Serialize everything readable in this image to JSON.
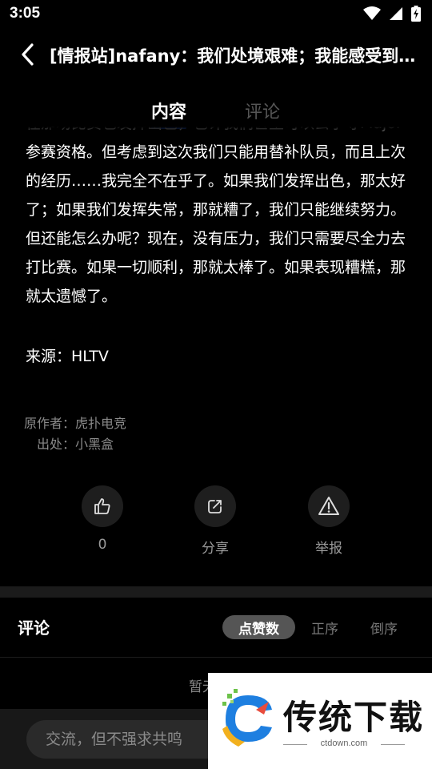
{
  "status_bar": {
    "time": "3:05"
  },
  "header": {
    "title": "[情报站]nafany：我们处境艰难；我能感受到…"
  },
  "tabs": [
    {
      "label": "内容",
      "active": true
    },
    {
      "label": "评论",
      "active": false
    }
  ],
  "article": {
    "paragraphs": [
      "在那场比赛也发挥出色，也许我们甚至可以去争夺Major参赛资格。但考虑到这次我们只能用替补队员，而且上次的经历……我完全不在乎了。如果我们发挥出色，那太好了；如果我们发挥失常，那就糟了，我们只能继续努力。但还能怎么办呢？现在，没有压力，我们只需要尽全力去打比赛。如果一切顺利，那就太棒了。如果表现糟糕，那就太遗憾了。"
    ],
    "source": "来源：HLTV"
  },
  "meta": {
    "author_label": "原作者：",
    "author": "虎扑电竞",
    "origin_label": "出处：",
    "origin": "小黑盒"
  },
  "actions": {
    "like_count": "0",
    "share_label": "分享",
    "report_label": "举报"
  },
  "comments": {
    "title": "评论",
    "sort_likes": "点赞数",
    "sort_asc": "正序",
    "sort_desc": "倒序",
    "empty_text": "暂无",
    "input_placeholder": "交流，但不强求共鸣"
  },
  "watermark": {
    "name": "传统下载",
    "url": "ctdown.com"
  },
  "colors": {
    "background": "#000000",
    "accent_blue": "#2f6fff",
    "muted_text": "#8a8a8a",
    "sort_active_bg": "#555555"
  }
}
